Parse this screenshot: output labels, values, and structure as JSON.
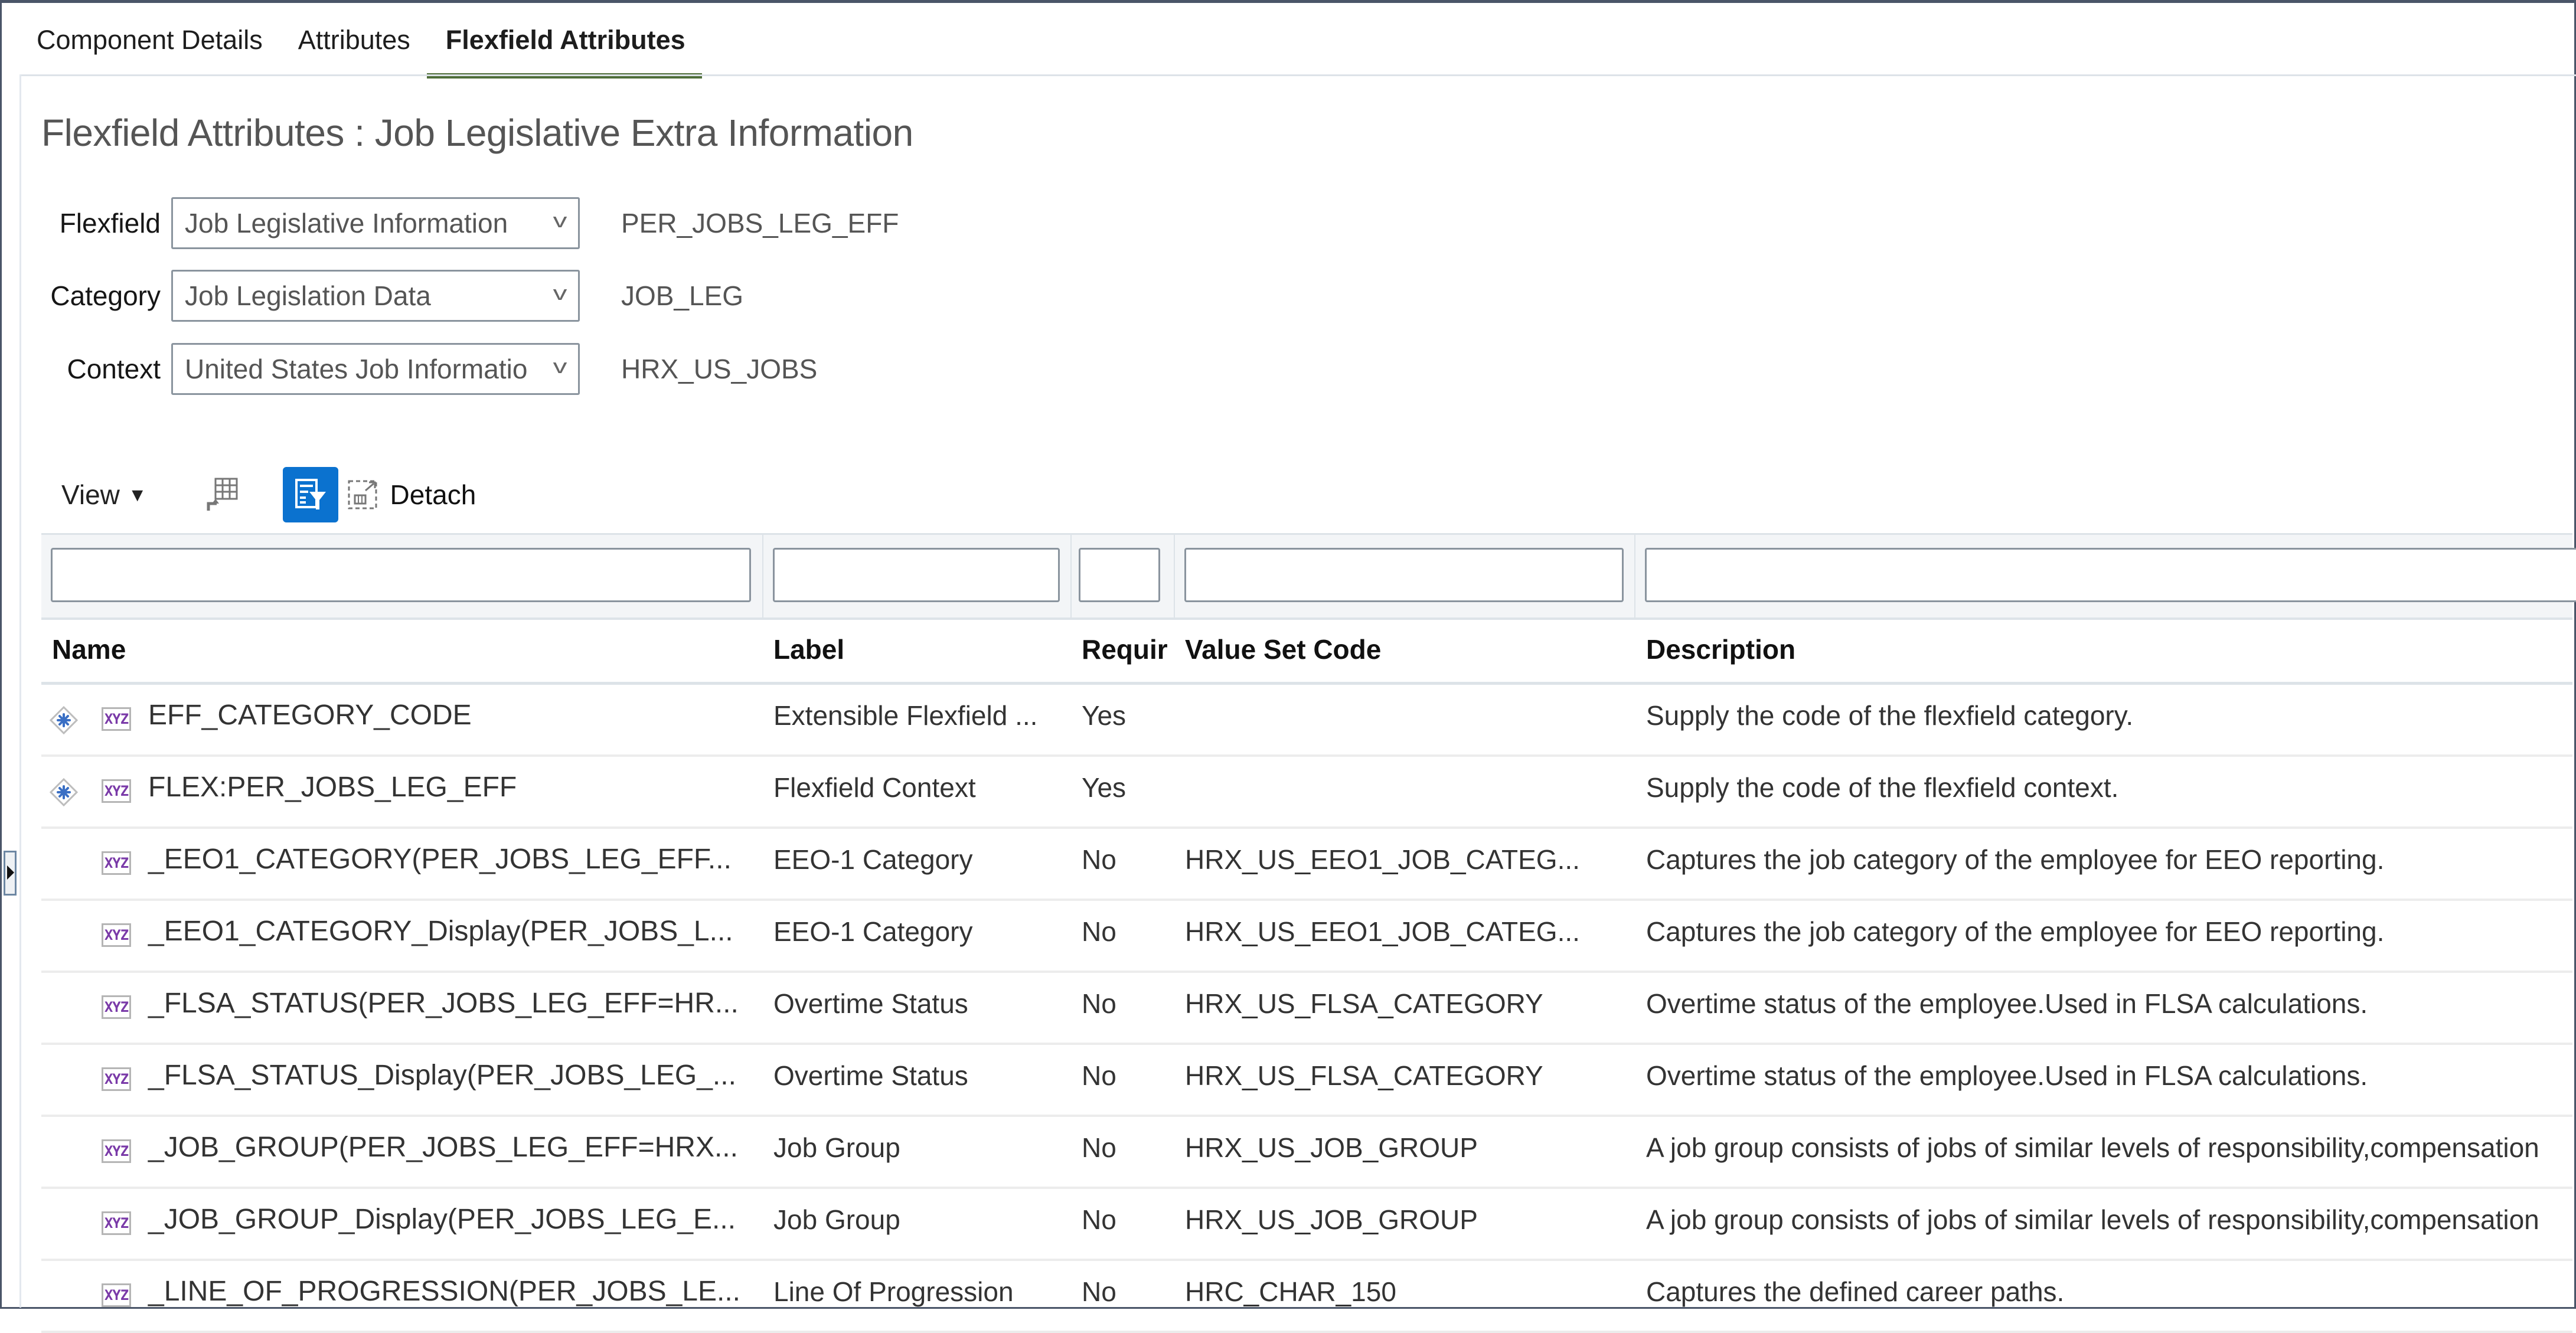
{
  "tabs": [
    {
      "label": "Component Details",
      "active": false
    },
    {
      "label": "Attributes",
      "active": false
    },
    {
      "label": "Flexfield Attributes",
      "active": true
    }
  ],
  "page_title": "Flexfield Attributes : Job Legislative Extra Information",
  "form": {
    "flexfield": {
      "label": "Flexfield",
      "value": "Job Legislative Information",
      "code": "PER_JOBS_LEG_EFF"
    },
    "category": {
      "label": "Category",
      "value": "Job Legislation Data",
      "code": "JOB_LEG"
    },
    "context": {
      "label": "Context",
      "value": "United States Job Information",
      "code": "HRX_US_JOBS"
    }
  },
  "toolbar": {
    "view_label": "View",
    "view_caret": "▼",
    "freeze_icon": "freeze-columns-icon",
    "query_by_example_icon": "query-by-example-icon",
    "query_by_example_active": true,
    "detach_label": "Detach"
  },
  "table": {
    "filters": {
      "name": "",
      "label": "",
      "required": "",
      "value_set_code": "",
      "description": ""
    },
    "columns": [
      "Name",
      "Label",
      "Requir",
      "Value Set Code",
      "Description"
    ],
    "rows": [
      {
        "required_icon": true,
        "name": "EFF_CATEGORY_CODE",
        "label": "Extensible Flexfield ...",
        "required": "Yes",
        "value_set_code": "",
        "description": "Supply the code of the flexfield category."
      },
      {
        "required_icon": true,
        "name": "FLEX:PER_JOBS_LEG_EFF",
        "label": "Flexfield Context",
        "required": "Yes",
        "value_set_code": "",
        "description": "Supply the code of the flexfield context."
      },
      {
        "required_icon": false,
        "name": "_EEO1_CATEGORY(PER_JOBS_LEG_EFF...",
        "label": "EEO-1 Category",
        "required": "No",
        "value_set_code": "HRX_US_EEO1_JOB_CATEG...",
        "description": "Captures the job category of the employee for EEO reporting."
      },
      {
        "required_icon": false,
        "name": "_EEO1_CATEGORY_Display(PER_JOBS_L...",
        "label": "EEO-1 Category",
        "required": "No",
        "value_set_code": "HRX_US_EEO1_JOB_CATEG...",
        "description": "Captures the job category of the employee for EEO reporting."
      },
      {
        "required_icon": false,
        "name": "_FLSA_STATUS(PER_JOBS_LEG_EFF=HR...",
        "label": "Overtime Status",
        "required": "No",
        "value_set_code": "HRX_US_FLSA_CATEGORY",
        "description": "Overtime status of the employee.Used in FLSA calculations."
      },
      {
        "required_icon": false,
        "name": "_FLSA_STATUS_Display(PER_JOBS_LEG_...",
        "label": "Overtime Status",
        "required": "No",
        "value_set_code": "HRX_US_FLSA_CATEGORY",
        "description": "Overtime status of the employee.Used in FLSA calculations."
      },
      {
        "required_icon": false,
        "name": "_JOB_GROUP(PER_JOBS_LEG_EFF=HRX...",
        "label": "Job Group",
        "required": "No",
        "value_set_code": "HRX_US_JOB_GROUP",
        "description": "A job group consists of jobs of similar levels of responsibility,compensation"
      },
      {
        "required_icon": false,
        "name": "_JOB_GROUP_Display(PER_JOBS_LEG_E...",
        "label": "Job Group",
        "required": "No",
        "value_set_code": "HRX_US_JOB_GROUP",
        "description": "A job group consists of jobs of similar levels of responsibility,compensation"
      },
      {
        "required_icon": false,
        "name": "_LINE_OF_PROGRESSION(PER_JOBS_LE...",
        "label": "Line Of Progression",
        "required": "No",
        "value_set_code": "HRC_CHAR_150",
        "description": "Captures the defined career paths."
      }
    ]
  },
  "colors": {
    "active_tab_underline": "#4f6e3a",
    "active_button": "#0b72cf",
    "xyz_icon": "#7a3aa8",
    "required_icon": "#3a6fc4"
  }
}
